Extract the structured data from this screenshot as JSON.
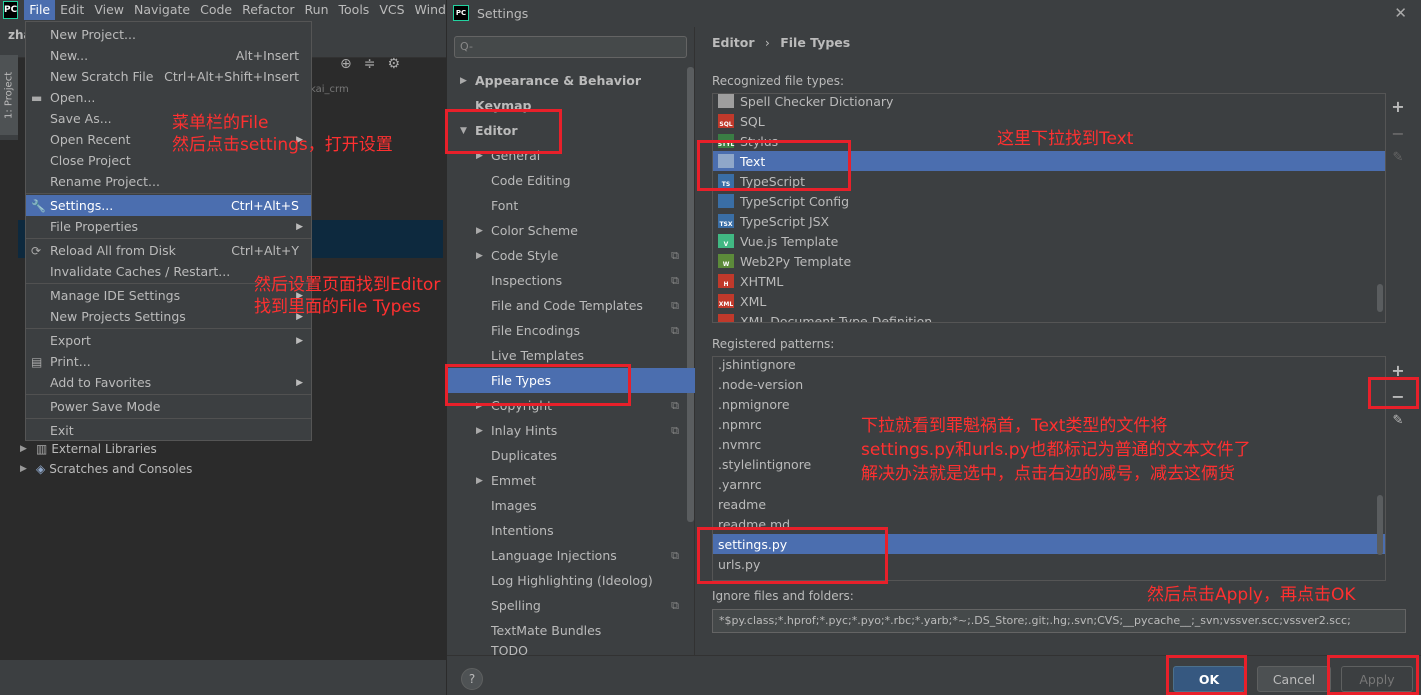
{
  "ide": {
    "logo": "PC",
    "menubar": [
      "File",
      "Edit",
      "View",
      "Navigate",
      "Code",
      "Refactor",
      "Run",
      "Tools",
      "VCS",
      "Wind"
    ],
    "project_name": "zha",
    "side_tab": "1: Project",
    "tree_hint": "kai_crm",
    "tree": [
      {
        "label": "External Libraries",
        "icon": "library-icon"
      },
      {
        "label": "Scratches and Consoles",
        "icon": "scratches-icon"
      }
    ]
  },
  "file_menu": {
    "items": [
      {
        "label": "New Project...",
        "shortcut": ""
      },
      {
        "label": "New...",
        "shortcut": "Alt+Insert"
      },
      {
        "label": "New Scratch File",
        "shortcut": "Ctrl+Alt+Shift+Insert"
      },
      {
        "label": "Open...",
        "shortcut": ""
      },
      {
        "label": "Save As...",
        "shortcut": ""
      },
      {
        "label": "Open Recent",
        "shortcut": ""
      },
      {
        "label": "Close Project",
        "shortcut": ""
      },
      {
        "label": "Rename Project...",
        "shortcut": ""
      },
      {
        "label": "Settings...",
        "shortcut": "Ctrl+Alt+S"
      },
      {
        "label": "File Properties",
        "shortcut": ""
      },
      {
        "label": "Reload All from Disk",
        "shortcut": "Ctrl+Alt+Y"
      },
      {
        "label": "Invalidate Caches / Restart...",
        "shortcut": ""
      },
      {
        "label": "Manage IDE Settings",
        "shortcut": ""
      },
      {
        "label": "New Projects Settings",
        "shortcut": ""
      },
      {
        "label": "Export",
        "shortcut": ""
      },
      {
        "label": "Print...",
        "shortcut": ""
      },
      {
        "label": "Add to Favorites",
        "shortcut": ""
      },
      {
        "label": "Power Save Mode",
        "shortcut": ""
      },
      {
        "label": "Exit",
        "shortcut": ""
      }
    ]
  },
  "dialog": {
    "title": "Settings",
    "logo": "PC",
    "search_placeholder": "Q-",
    "tree": [
      {
        "label": "Appearance & Behavior"
      },
      {
        "label": "Keymap"
      },
      {
        "label": "Editor"
      },
      {
        "label": "General"
      },
      {
        "label": "Code Editing"
      },
      {
        "label": "Font"
      },
      {
        "label": "Color Scheme"
      },
      {
        "label": "Code Style"
      },
      {
        "label": "Inspections"
      },
      {
        "label": "File and Code Templates"
      },
      {
        "label": "File Encodings"
      },
      {
        "label": "Live Templates"
      },
      {
        "label": "File Types"
      },
      {
        "label": "Copyright"
      },
      {
        "label": "Inlay Hints"
      },
      {
        "label": "Duplicates"
      },
      {
        "label": "Emmet"
      },
      {
        "label": "Images"
      },
      {
        "label": "Intentions"
      },
      {
        "label": "Language Injections"
      },
      {
        "label": "Log Highlighting (Ideolog)"
      },
      {
        "label": "Spelling"
      },
      {
        "label": "TextMate Bundles"
      },
      {
        "label": "TODO"
      }
    ],
    "breadcrumb": {
      "parent": "Editor",
      "sep": "›",
      "current": "File Types"
    },
    "recognized_label": "Recognized file types:",
    "file_types": [
      {
        "label": "Spell Checker Dictionary",
        "badge": "",
        "color": "#9e9e9e"
      },
      {
        "label": "SQL",
        "badge": "SQL",
        "color": "#c0392b"
      },
      {
        "label": "Stylus",
        "badge": "STYL",
        "color": "#3a7d44"
      },
      {
        "label": "Text",
        "badge": "",
        "color": "#8fa7c9"
      },
      {
        "label": "TypeScript",
        "badge": "TS",
        "color": "#3a6ea5"
      },
      {
        "label": "TypeScript Config",
        "badge": "",
        "color": "#3a6ea5"
      },
      {
        "label": "TypeScript JSX",
        "badge": "TSX",
        "color": "#3a6ea5"
      },
      {
        "label": "Vue.js Template",
        "badge": "V",
        "color": "#41b883"
      },
      {
        "label": "Web2Py Template",
        "badge": "W",
        "color": "#5c8a3a"
      },
      {
        "label": "XHTML",
        "badge": "H",
        "color": "#c0392b"
      },
      {
        "label": "XML",
        "badge": "XML",
        "color": "#c0392b"
      },
      {
        "label": "XML Document Type Definition",
        "badge": "",
        "color": "#c0392b"
      }
    ],
    "patterns_label": "Registered patterns:",
    "patterns": [
      ".jshintignore",
      ".node-version",
      ".npmignore",
      ".npmrc",
      ".nvmrc",
      ".stylelintignore",
      ".yarnrc",
      "readme",
      "readme.md",
      "settings.py",
      "urls.py"
    ],
    "ignore_label": "Ignore files and folders:",
    "ignore_value": "*$py.class;*.hprof;*.pyc;*.pyo;*.rbc;*.yarb;*~;.DS_Store;.git;.hg;.svn;CVS;__pycache__;_svn;vssver.scc;vssver2.scc;",
    "buttons": {
      "ok": "OK",
      "cancel": "Cancel",
      "apply": "Apply",
      "help": "?"
    }
  },
  "annotations": {
    "file_menu_note": [
      "菜单栏的File",
      "然后点击settings，打开设置"
    ],
    "editor_note": [
      "然后设置页面找到Editor",
      "找到里面的File Types"
    ],
    "text_note": "这里下拉找到Text",
    "patterns_note": [
      "下拉就看到罪魁祸首，Text类型的文件将",
      "settings.py和urls.py也都标记为普通的文本文件了",
      "解决办法就是选中，点击右边的减号，减去这俩货"
    ],
    "apply_note": "然后点击Apply，再点击OK",
    "box_color": "#e8202a"
  }
}
